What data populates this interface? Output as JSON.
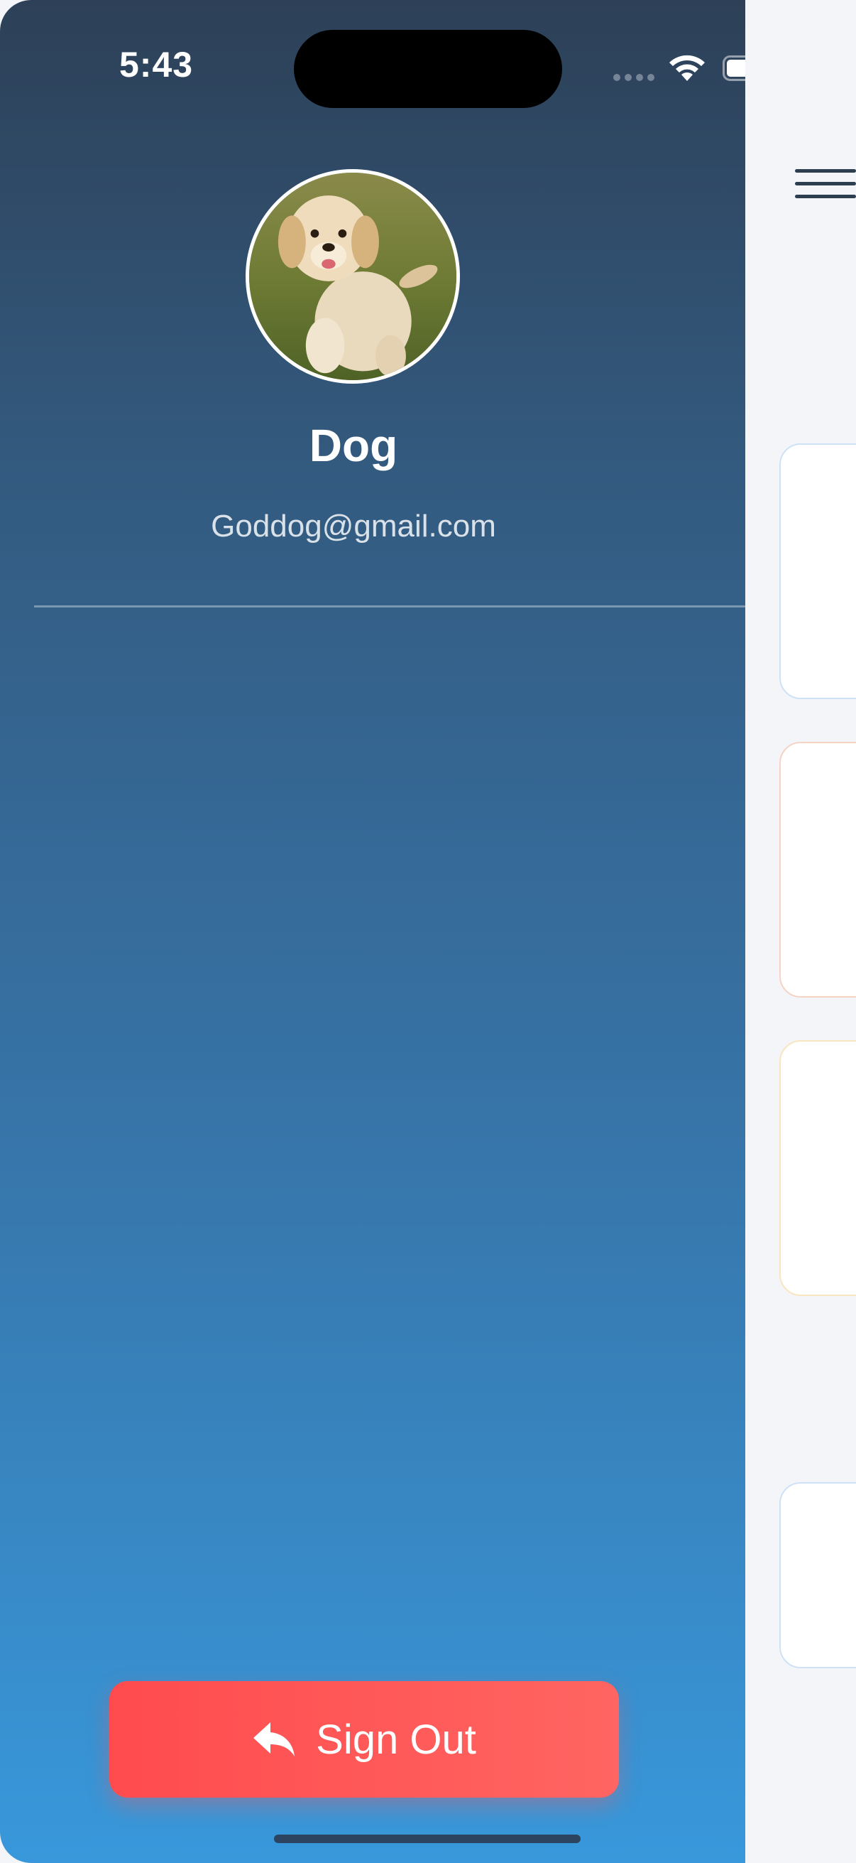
{
  "status_bar": {
    "time": "5:43"
  },
  "profile": {
    "name": "Dog",
    "email": "Goddog@gmail.com",
    "avatar_icon": "dog-photo"
  },
  "drawer": {
    "sign_out_label": "Sign Out",
    "sign_out_icon": "reply-arrow-icon"
  },
  "main_peek": {
    "menu_icon": "hamburger-menu-icon",
    "card_accent_colors": [
      "#cde2f6",
      "#f6d4c4",
      "#f7e6bf",
      "#cfe1f5"
    ]
  },
  "colors": {
    "drawer_gradient_top": "#2d4057",
    "drawer_gradient_bottom": "#3898db",
    "sign_out_button": "#ff5555",
    "background": "#f3f5f9"
  }
}
